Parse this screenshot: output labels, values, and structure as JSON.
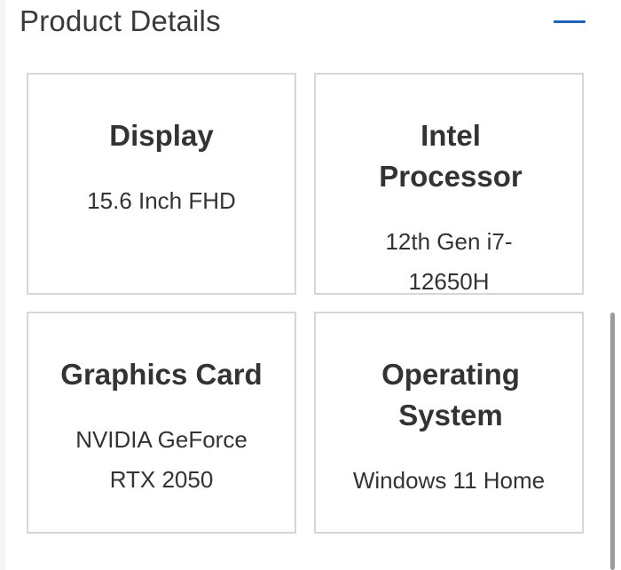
{
  "section": {
    "title": "Product Details",
    "toggle_icon": "minus-icon",
    "accent_color": "#1f63b3"
  },
  "specs": [
    {
      "title": "Display",
      "value": "15.6 Inch FHD"
    },
    {
      "title": "Intel Processor",
      "value": "12th Gen i7-12650H"
    },
    {
      "title": "Graphics Card",
      "value": "NVIDIA GeForce RTX 2050"
    },
    {
      "title": "Operating System",
      "value": "Windows 11 Home"
    }
  ]
}
